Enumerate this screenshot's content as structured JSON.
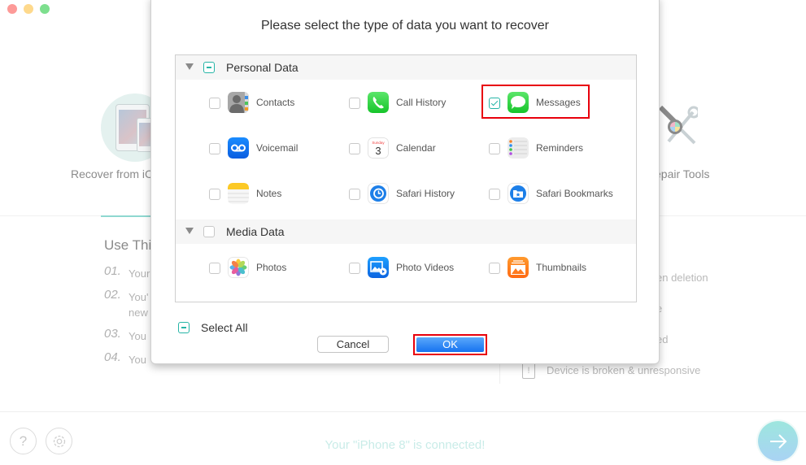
{
  "window": {
    "controls": [
      "close",
      "minimize",
      "zoom"
    ]
  },
  "background": {
    "modes": [
      {
        "label": "Recover from iC",
        "icon": "ipad-iphone-icon"
      },
      {
        "label": "epair Tools",
        "icon": "repair-tools-icon"
      }
    ],
    "use_title": "Use Thi",
    "steps": [
      {
        "num": "01.",
        "text": "Your"
      },
      {
        "num": "02.",
        "text": "You'",
        "text2": "new"
      },
      {
        "num": "03.",
        "text": "You"
      },
      {
        "num": "04.",
        "text": "You"
      }
    ],
    "right_items": [
      "en deletion",
      "e",
      "ed",
      "Device is broken & unresponsive"
    ],
    "status": "Your \"iPhone 8\" is connected!",
    "help_label": "?",
    "accent_color": "#8fd8d0"
  },
  "dialog": {
    "title": "Please select the type of data you want to recover",
    "groups": [
      {
        "label": "Personal Data",
        "state": "partial",
        "items": [
          {
            "label": "Contacts",
            "checked": false,
            "icon": "contacts-icon"
          },
          {
            "label": "Call History",
            "checked": false,
            "icon": "phone-icon"
          },
          {
            "label": "Messages",
            "checked": true,
            "icon": "messages-icon",
            "highlighted": true
          },
          {
            "label": "Voicemail",
            "checked": false,
            "icon": "voicemail-icon"
          },
          {
            "label": "Calendar",
            "checked": false,
            "icon": "calendar-icon",
            "day_name": "Sunday",
            "day_number": "3"
          },
          {
            "label": "Reminders",
            "checked": false,
            "icon": "reminders-icon"
          },
          {
            "label": "Notes",
            "checked": false,
            "icon": "notes-icon"
          },
          {
            "label": "Safari History",
            "checked": false,
            "icon": "safari-history-icon"
          },
          {
            "label": "Safari Bookmarks",
            "checked": false,
            "icon": "safari-bookmarks-icon"
          }
        ]
      },
      {
        "label": "Media Data",
        "state": "unchecked",
        "items": [
          {
            "label": "Photos",
            "checked": false,
            "icon": "photos-icon"
          },
          {
            "label": "Photo Videos",
            "checked": false,
            "icon": "photo-videos-icon"
          },
          {
            "label": "Thumbnails",
            "checked": false,
            "icon": "thumbnails-icon"
          }
        ]
      }
    ],
    "select_all": {
      "label": "Select All",
      "state": "partial"
    },
    "cancel_label": "Cancel",
    "ok_label": "OK",
    "highlight_color": "#e8000b",
    "check_color": "#26b5a6"
  }
}
